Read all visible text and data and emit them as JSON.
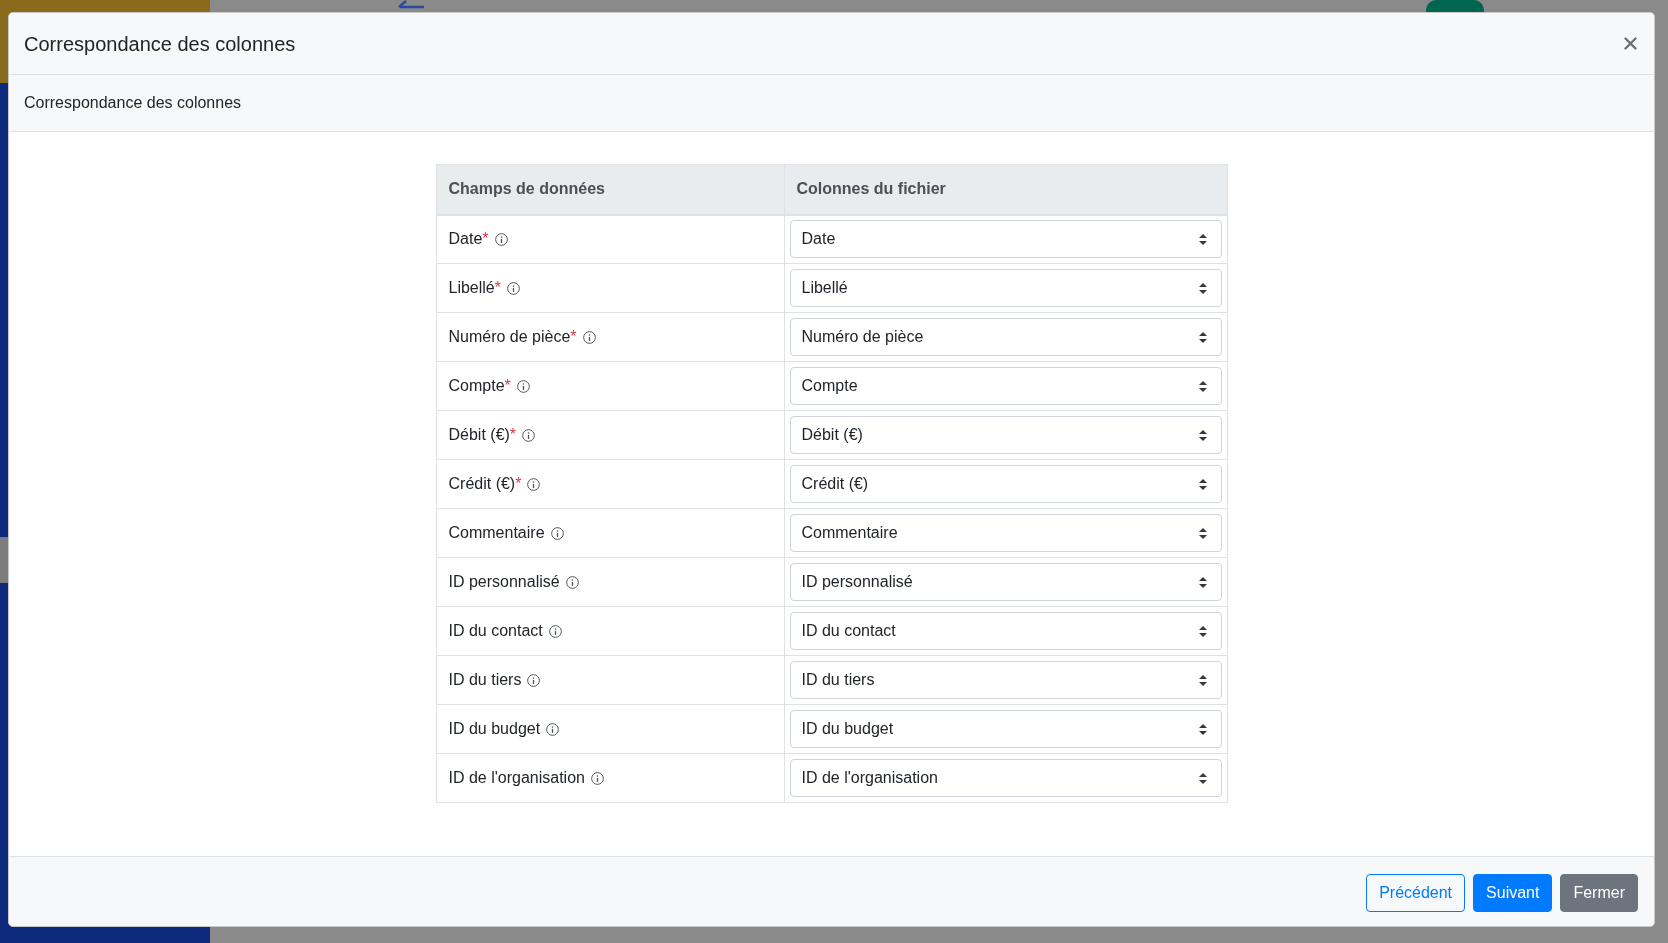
{
  "modal": {
    "title": "Correspondance des colonnes",
    "step_title": "Correspondance des colonnes"
  },
  "table": {
    "columns": [
      "Champs de données",
      "Colonnes du fichier"
    ],
    "rows": [
      {
        "data_field": {
          "label": "Date",
          "required_mark": "*"
        },
        "file_column": "Date"
      },
      {
        "data_field": {
          "label": "Libellé",
          "required_mark": "*"
        },
        "file_column": "Libellé"
      },
      {
        "data_field": {
          "label": "Numéro de pièce",
          "required_mark": "*"
        },
        "file_column": "Numéro de pièce"
      },
      {
        "data_field": {
          "label": "Compte",
          "required_mark": "*"
        },
        "file_column": "Compte"
      },
      {
        "data_field": {
          "label": "Débit (€)",
          "required_mark": "*"
        },
        "file_column": "Débit (€)"
      },
      {
        "data_field": {
          "label": "Crédit (€)",
          "required_mark": "*"
        },
        "file_column": "Crédit (€)"
      },
      {
        "data_field": {
          "label": "Commentaire"
        },
        "file_column": "Commentaire"
      },
      {
        "data_field": {
          "label": "ID personnalisé"
        },
        "file_column": "ID personnalisé"
      },
      {
        "data_field": {
          "label": "ID du contact"
        },
        "file_column": "ID du contact"
      },
      {
        "data_field": {
          "label": "ID du tiers"
        },
        "file_column": "ID du tiers"
      },
      {
        "data_field": {
          "label": "ID du budget"
        },
        "file_column": "ID du budget"
      },
      {
        "data_field": {
          "label": "ID de l'organisation"
        },
        "file_column": "ID de l'organisation"
      }
    ]
  },
  "buttons": [
    {
      "label": "Précédent",
      "kind": "outline"
    },
    {
      "label": "Suivant",
      "kind": "primary"
    },
    {
      "label": "Fermer",
      "kind": "secondary"
    }
  ]
}
